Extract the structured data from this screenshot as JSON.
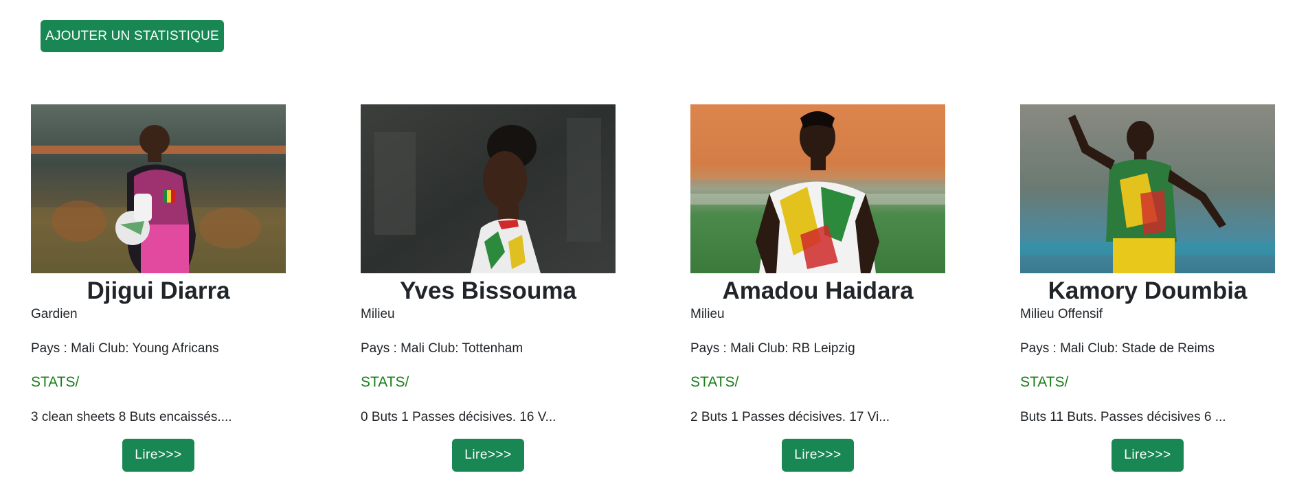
{
  "toolbar": {
    "add_label": "AJOUTER UN STATISTIQUE"
  },
  "colors": {
    "accent": "#198754",
    "stats_green": "#1a7f1a"
  },
  "players": [
    {
      "name": "Djigui Diarra",
      "position": "Gardien",
      "country_club": "Pays : Mali Club: Young Africans",
      "stats_title": "STATS/",
      "stats": "3 clean sheets 8 Buts encaissés....",
      "read_label": "Lire>>>",
      "photo": "player-photo"
    },
    {
      "name": "Yves Bissouma",
      "position": "Milieu",
      "country_club": "Pays : Mali Club: Tottenham",
      "stats_title": "STATS/",
      "stats": "0 Buts 1 Passes décisives. 16 V...",
      "read_label": "Lire>>>",
      "photo": "player-photo"
    },
    {
      "name": "Amadou Haidara",
      "position": "Milieu",
      "country_club": "Pays : Mali Club: RB Leipzig",
      "stats_title": "STATS/",
      "stats": "2 Buts 1 Passes décisives. 17 Vi...",
      "read_label": "Lire>>>",
      "photo": "player-photo"
    },
    {
      "name": "Kamory Doumbia",
      "position": "Milieu Offensif",
      "country_club": "Pays : Mali Club: Stade de Reims",
      "stats_title": "STATS/",
      "stats": "Buts 11 Buts. Passes décisives 6 ...",
      "read_label": "Lire>>>",
      "photo": "player-photo"
    }
  ]
}
